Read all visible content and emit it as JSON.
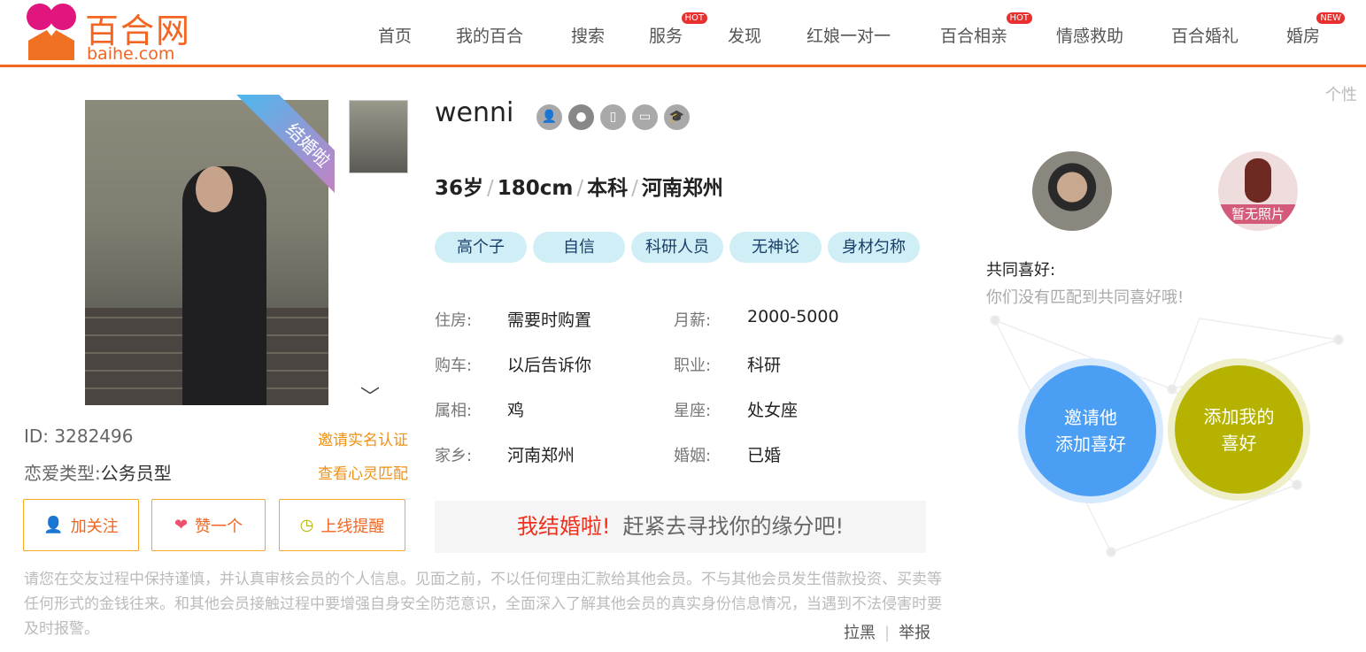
{
  "header": {
    "logo_cn": "百合网",
    "logo_en": "baihe.com",
    "nav": [
      {
        "label": "首页"
      },
      {
        "label": "我的百合"
      },
      {
        "label": "搜索"
      },
      {
        "label": "服务",
        "badge": "HOT"
      },
      {
        "label": "发现"
      },
      {
        "label": "红娘一对一"
      },
      {
        "label": "百合相亲",
        "badge": "HOT"
      },
      {
        "label": "情感救助"
      },
      {
        "label": "百合婚礼"
      },
      {
        "label": "婚房",
        "badge": "NEW"
      }
    ]
  },
  "photo": {
    "ribbon": "结婚啦"
  },
  "left": {
    "id_label": "ID:",
    "id_value": "3282496",
    "love_type_label": "恋爱类型:",
    "love_type_value": "公务员型",
    "invite_verify": "邀请实名认证",
    "soul_match": "查看心灵匹配",
    "follow": "加关注",
    "like": "赞一个",
    "online_remind": "上线提醒"
  },
  "profile": {
    "name": "wenni",
    "verify_icons": [
      "user-verified-icon",
      "fire-icon",
      "phone-icon",
      "id-card-icon",
      "education-icon"
    ],
    "age": "36岁",
    "height": "180cm",
    "education": "本科",
    "location": "河南郑州",
    "tags": [
      "高个子",
      "自信",
      "科研人员",
      "无神论",
      "身材匀称"
    ],
    "details": [
      {
        "label": "住房:",
        "value": "需要时购置"
      },
      {
        "label": "月薪:",
        "value": "2000-5000"
      },
      {
        "label": "购车:",
        "value": "以后告诉你"
      },
      {
        "label": "职业:",
        "value": "科研"
      },
      {
        "label": "属相:",
        "value": "鸡"
      },
      {
        "label": "星座:",
        "value": "处女座"
      },
      {
        "label": "家乡:",
        "value": "河南郑州"
      },
      {
        "label": "婚姻:",
        "value": "已婚"
      }
    ],
    "married_banner": "我结婚啦!",
    "married_sub": "赶紧去寻找你的缘分吧!"
  },
  "notice": "请您在交友过程中保持谨慎，并认真审核会员的个人信息。见面之前，不以任何理由汇款给其他会员。不与其他会员发生借款投资、买卖等任何形式的金钱往来。和其他会员接触过程中要增强自身安全防范意识，全面深入了解其他会员的真实身份信息情况，当遇到不法侵害时要及时报警。",
  "footer_links": {
    "block": "拉黑",
    "report": "举报"
  },
  "right": {
    "top_link": "个性",
    "no_photo": "暂无照片",
    "common_title": "共同喜好:",
    "common_empty": "你们没有匹配到共同喜好哦!",
    "invite_btn": "邀请他\n添加喜好",
    "add_btn": "添加我的\n喜好"
  },
  "colors": {
    "brand": "#f26522",
    "invite": "#4a9ff5",
    "add": "#b5b300"
  }
}
